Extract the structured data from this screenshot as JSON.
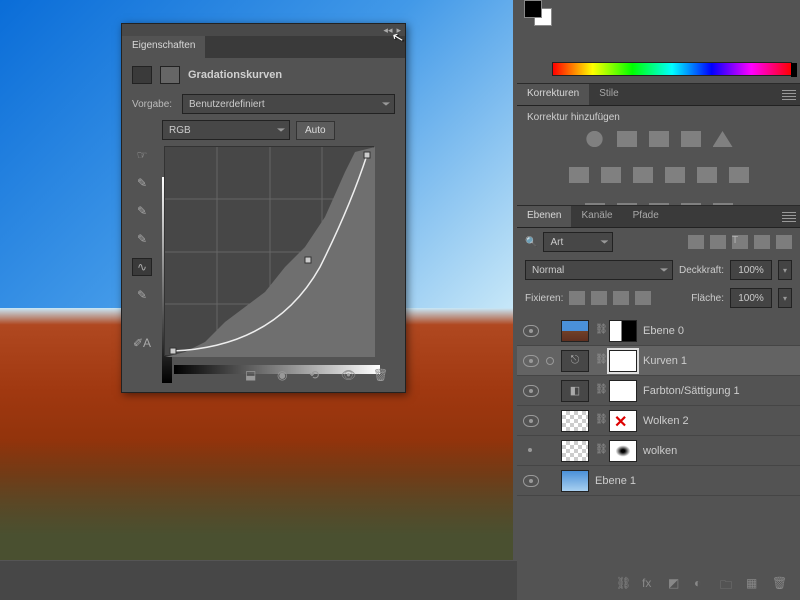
{
  "properties_panel": {
    "tab": "Eigenschaften",
    "title": "Gradationskurven",
    "preset_label": "Vorgabe:",
    "preset_value": "Benutzerdefiniert",
    "channel_value": "RGB",
    "auto_button": "Auto"
  },
  "korrekturen_panel": {
    "tabs": [
      "Korrekturen",
      "Stile"
    ],
    "active_tab": 0,
    "header": "Korrektur hinzufügen"
  },
  "ebenen_panel": {
    "tabs": [
      "Ebenen",
      "Kanäle",
      "Pfade"
    ],
    "active_tab": 0,
    "filter_label": "Art",
    "blend_mode": "Normal",
    "opacity_label": "Deckkraft:",
    "opacity_value": "100%",
    "fill_label": "Fläche:",
    "fill_value": "100%",
    "lock_label": "Fixieren:",
    "layers": [
      {
        "name": "Ebene 0"
      },
      {
        "name": "Kurven 1"
      },
      {
        "name": "Farbton/Sättigung 1"
      },
      {
        "name": "Wolken 2"
      },
      {
        "name": "wolken"
      },
      {
        "name": "Ebene 1"
      }
    ]
  },
  "search_icon": "🔍"
}
